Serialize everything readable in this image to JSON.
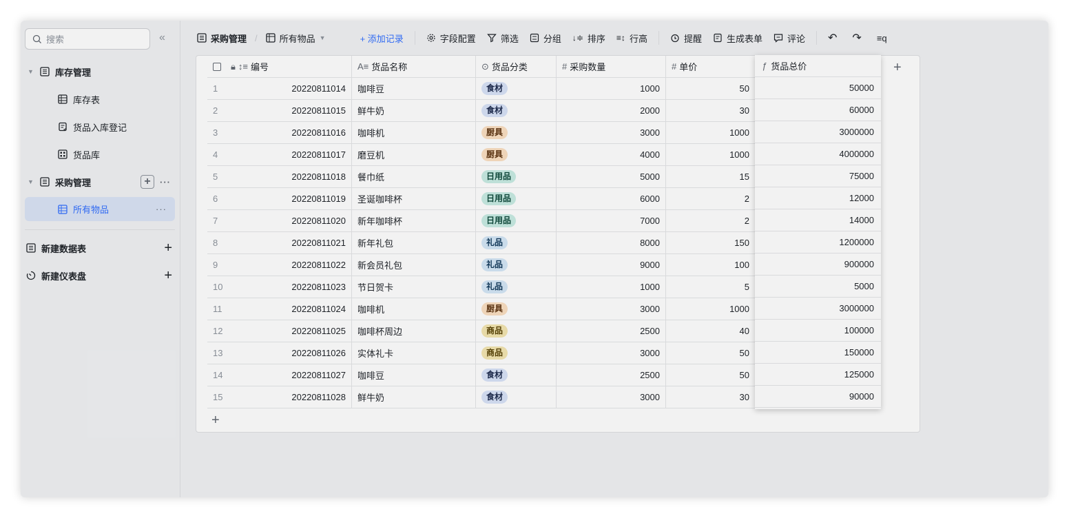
{
  "sidebar": {
    "search_placeholder": "搜索",
    "collapse_glyph": "«",
    "groups": [
      {
        "label": "库存管理",
        "items": [
          "库存表",
          "货品入库登记",
          "货品库"
        ]
      },
      {
        "label": "采购管理",
        "items": [
          "所有物品"
        ]
      }
    ],
    "new_table": "新建数据表",
    "new_dashboard": "新建仪表盘",
    "more": "···"
  },
  "toolbar": {
    "crumb_base": "采购管理",
    "crumb_view": "所有物品",
    "add_record": "+ 添加记录",
    "field_config": "字段配置",
    "filter": "筛选",
    "group": "分组",
    "sort": "排序",
    "row_height": "行高",
    "reminder": "提醒",
    "form": "生成表单",
    "comment": "评论"
  },
  "grid": {
    "columns": [
      "编号",
      "货品名称",
      "货品分类",
      "采购数量",
      "单价",
      "货品总价"
    ],
    "column_icons": [
      "sort-number-icon",
      "text-field-icon",
      "select-field-icon",
      "number-field-icon",
      "number-field-icon",
      "formula-field-icon"
    ],
    "rows": [
      {
        "idx": "1",
        "num": "20220811014",
        "name": "咖啡豆",
        "cat": "食材",
        "qty": "1000",
        "price": "50",
        "total": "50000"
      },
      {
        "idx": "2",
        "num": "20220811015",
        "name": "鲜牛奶",
        "cat": "食材",
        "qty": "2000",
        "price": "30",
        "total": "60000"
      },
      {
        "idx": "3",
        "num": "20220811016",
        "name": "咖啡机",
        "cat": "厨具",
        "qty": "3000",
        "price": "1000",
        "total": "3000000"
      },
      {
        "idx": "4",
        "num": "20220811017",
        "name": "磨豆机",
        "cat": "厨具",
        "qty": "4000",
        "price": "1000",
        "total": "4000000"
      },
      {
        "idx": "5",
        "num": "20220811018",
        "name": "餐巾纸",
        "cat": "日用品",
        "qty": "5000",
        "price": "15",
        "total": "75000"
      },
      {
        "idx": "6",
        "num": "20220811019",
        "name": "圣诞咖啡杯",
        "cat": "日用品",
        "qty": "6000",
        "price": "2",
        "total": "12000"
      },
      {
        "idx": "7",
        "num": "20220811020",
        "name": "新年咖啡杯",
        "cat": "日用品",
        "qty": "7000",
        "price": "2",
        "total": "14000"
      },
      {
        "idx": "8",
        "num": "20220811021",
        "name": "新年礼包",
        "cat": "礼品",
        "qty": "8000",
        "price": "150",
        "total": "1200000"
      },
      {
        "idx": "9",
        "num": "20220811022",
        "name": "新会员礼包",
        "cat": "礼品",
        "qty": "9000",
        "price": "100",
        "total": "900000"
      },
      {
        "idx": "10",
        "num": "20220811023",
        "name": "节日贺卡",
        "cat": "礼品",
        "qty": "1000",
        "price": "5",
        "total": "5000"
      },
      {
        "idx": "11",
        "num": "20220811024",
        "name": "咖啡机",
        "cat": "厨具",
        "qty": "3000",
        "price": "1000",
        "total": "3000000"
      },
      {
        "idx": "12",
        "num": "20220811025",
        "name": "咖啡杯周边",
        "cat": "商品",
        "qty": "2500",
        "price": "40",
        "total": "100000"
      },
      {
        "idx": "13",
        "num": "20220811026",
        "name": "实体礼卡",
        "cat": "商品",
        "qty": "3000",
        "price": "50",
        "total": "150000"
      },
      {
        "idx": "14",
        "num": "20220811027",
        "name": "咖啡豆",
        "cat": "食材",
        "qty": "2500",
        "price": "50",
        "total": "125000"
      },
      {
        "idx": "15",
        "num": "20220811028",
        "name": "鲜牛奶",
        "cat": "食材",
        "qty": "3000",
        "price": "30",
        "total": "90000"
      }
    ]
  },
  "colors": {
    "accent": "#3370ff",
    "active_bg": "#dbe4f6"
  }
}
